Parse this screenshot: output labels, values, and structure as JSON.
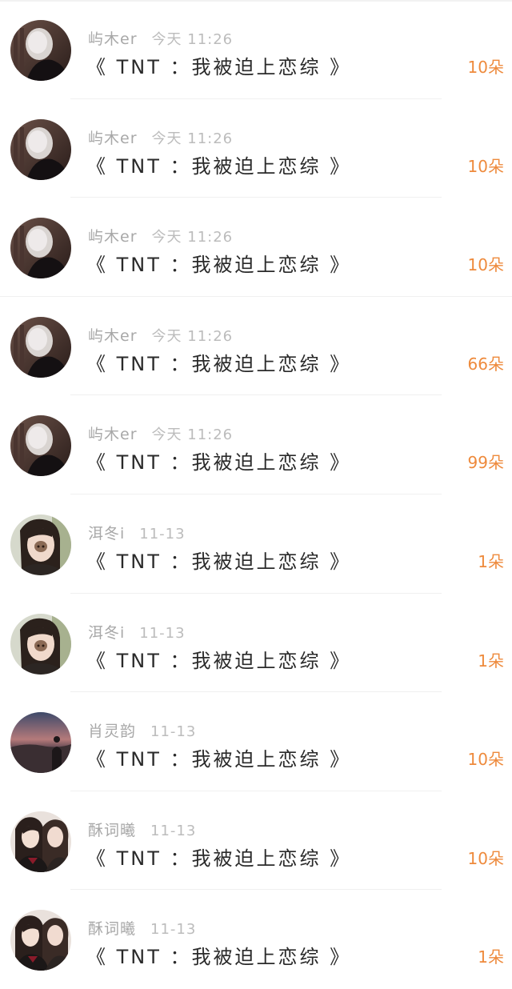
{
  "rows": [
    {
      "name": "屿木er",
      "time": "今天 11:26",
      "title": "《 TNT ：我被迫上恋综 》",
      "count": "10朵",
      "avatar": "dark-portrait",
      "avatar_icon": "user-avatar-icon"
    },
    {
      "name": "屿木er",
      "time": "今天 11:26",
      "title": "《 TNT ：我被迫上恋综 》",
      "count": "10朵",
      "avatar": "dark-portrait",
      "avatar_icon": "user-avatar-icon"
    },
    {
      "name": "屿木er",
      "time": "今天 11:26",
      "title": "《 TNT ：我被迫上恋综 》",
      "count": "10朵",
      "avatar": "dark-portrait",
      "avatar_icon": "user-avatar-icon"
    },
    {
      "name": "屿木er",
      "time": "今天 11:26",
      "title": "《 TNT ：我被迫上恋综 》",
      "count": "66朵",
      "avatar": "dark-portrait",
      "avatar_icon": "user-avatar-icon"
    },
    {
      "name": "屿木er",
      "time": "今天 11:26",
      "title": "《 TNT ：我被迫上恋综 》",
      "count": "99朵",
      "avatar": "dark-portrait",
      "avatar_icon": "user-avatar-icon"
    },
    {
      "name": "洱冬i",
      "time": "11-13",
      "title": "《 TNT ：我被迫上恋综 》",
      "count": "1朵",
      "avatar": "girl-portrait",
      "avatar_icon": "user-avatar-icon"
    },
    {
      "name": "洱冬i",
      "time": "11-13",
      "title": "《 TNT ：我被迫上恋综 》",
      "count": "1朵",
      "avatar": "girl-portrait",
      "avatar_icon": "user-avatar-icon"
    },
    {
      "name": "肖灵韵",
      "time": "11-13",
      "title": "《 TNT ：我被迫上恋综 》",
      "count": "10朵",
      "avatar": "sunset-silhouette",
      "avatar_icon": "user-avatar-icon"
    },
    {
      "name": "酥词曦",
      "time": "11-13",
      "title": "《 TNT ：我被迫上恋综 》",
      "count": "10朵",
      "avatar": "two-girls",
      "avatar_icon": "user-avatar-icon"
    },
    {
      "name": "酥词曦",
      "time": "11-13",
      "title": "《 TNT ：我被迫上恋综 》",
      "count": "1朵",
      "avatar": "two-girls",
      "avatar_icon": "user-avatar-icon"
    }
  ],
  "colors": {
    "accent": "#ee8a3c",
    "title_text": "#2a2a2a",
    "meta_text": "#a8a8a8",
    "divider": "#f0f0f0"
  }
}
